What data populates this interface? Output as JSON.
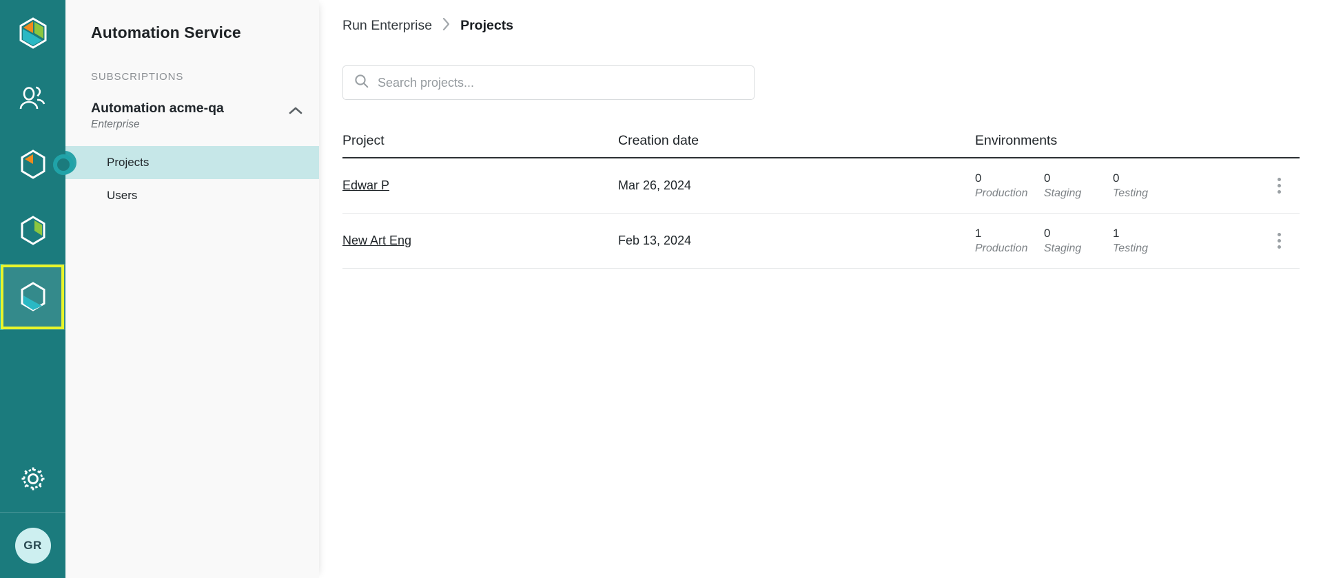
{
  "rail": {
    "logo_icon": "hexagon-logo-icon",
    "items": [
      {
        "icon": "users-group-icon",
        "name": "rail-item-users",
        "selected": false,
        "badge": false
      },
      {
        "icon": "hexagon-orange-icon",
        "name": "rail-item-workloads",
        "selected": false,
        "badge": true
      },
      {
        "icon": "hexagon-green-icon",
        "name": "rail-item-assets",
        "selected": false,
        "badge": false
      },
      {
        "icon": "hexagon-cyan-icon",
        "name": "rail-item-automation-service",
        "selected": true,
        "badge": false
      }
    ],
    "settings_icon": "gear-icon",
    "avatar_initials": "GR"
  },
  "sidebar": {
    "title": "Automation Service",
    "section_label": "SUBSCRIPTIONS",
    "subscription": {
      "name": "Automation acme-qa",
      "plan": "Enterprise",
      "collapse_icon": "chevron-up-icon"
    },
    "items": [
      {
        "label": "Projects",
        "active": true
      },
      {
        "label": "Users",
        "active": false
      }
    ]
  },
  "breadcrumb": {
    "parent": "Run Enterprise",
    "separator": "›",
    "current": "Projects"
  },
  "search": {
    "icon": "search-icon",
    "placeholder": "Search projects...",
    "value": ""
  },
  "table": {
    "columns": {
      "project": "Project",
      "creation_date": "Creation date",
      "environments": "Environments"
    },
    "env_labels": {
      "production": "Production",
      "staging": "Staging",
      "testing": "Testing"
    },
    "row_menu_icon": "kebab-menu-icon",
    "rows": [
      {
        "project": "Edwar P",
        "creation_date": "Mar 26, 2024",
        "production": "0",
        "production_label": "Production",
        "staging": "0",
        "staging_label": "Staging",
        "testing": "0",
        "testing_label": "Testing"
      },
      {
        "project": "New Art Eng",
        "creation_date": "Feb 13, 2024",
        "production": "1",
        "production_label": "Production",
        "staging": "0",
        "staging_label": "Staging",
        "testing": "1",
        "testing_label": "Testing"
      }
    ]
  },
  "colors": {
    "rail_bg": "#1b7b7d",
    "rail_selected_bg": "#348a8b",
    "rail_selected_indicator": "#2ab8c4",
    "annotation_highlight": "#e8f52a",
    "sidebar_bg": "#f9f9f9",
    "sidebar_active_bg": "#c6e7e8",
    "accent_teal": "#2aa3a8",
    "avatar_bg": "#cdeff0",
    "logo_orange": "#f08a1e",
    "logo_green": "#8cc63f",
    "logo_cyan": "#2ab8c4"
  }
}
